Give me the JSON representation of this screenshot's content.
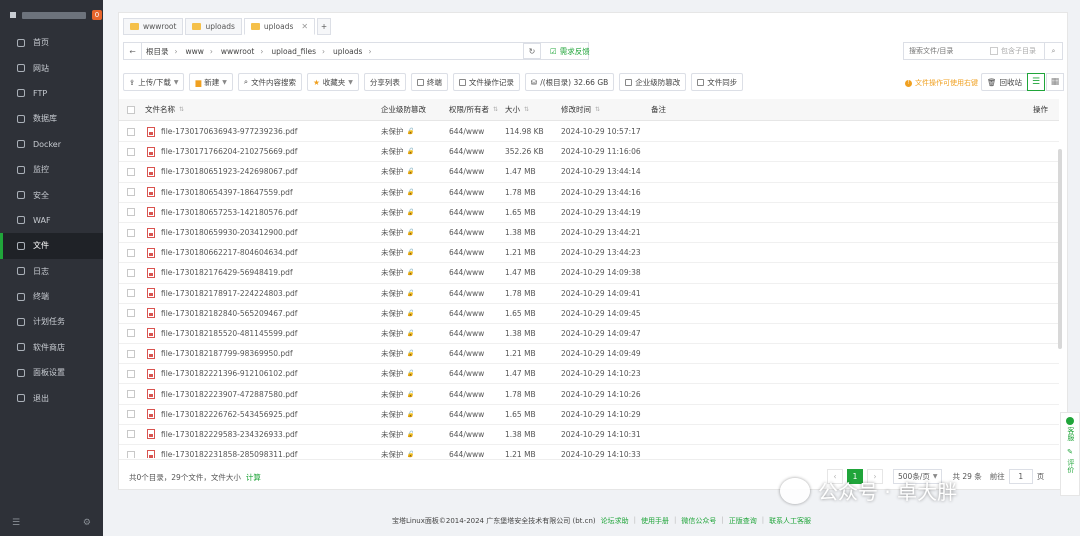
{
  "sidebar": {
    "badge": "0",
    "items": [
      {
        "label": "首页",
        "icon": "home-icon"
      },
      {
        "label": "网站",
        "icon": "globe-icon"
      },
      {
        "label": "FTP",
        "icon": "ftp-icon"
      },
      {
        "label": "数据库",
        "icon": "database-icon"
      },
      {
        "label": "Docker",
        "icon": "docker-icon"
      },
      {
        "label": "监控",
        "icon": "monitor-icon"
      },
      {
        "label": "安全",
        "icon": "shield-icon"
      },
      {
        "label": "WAF",
        "icon": "waf-icon"
      },
      {
        "label": "文件",
        "icon": "folder-icon",
        "active": true
      },
      {
        "label": "日志",
        "icon": "log-icon"
      },
      {
        "label": "终端",
        "icon": "terminal-icon"
      },
      {
        "label": "计划任务",
        "icon": "clock-icon"
      },
      {
        "label": "软件商店",
        "icon": "store-icon"
      },
      {
        "label": "面板设置",
        "icon": "settings-icon"
      },
      {
        "label": "退出",
        "icon": "logout-icon"
      }
    ]
  },
  "tabs": [
    {
      "label": "wwwroot"
    },
    {
      "label": "uploads"
    },
    {
      "label": "uploads",
      "active": true
    }
  ],
  "tab_add": "+",
  "tab_close": "✕",
  "path": {
    "crumbs": [
      "根目录",
      "www",
      "wwwroot",
      "upload_files",
      "uploads"
    ],
    "feedback": "需求反馈"
  },
  "search": {
    "placeholder": "搜索文件/目录",
    "include_sub": "包含子目录"
  },
  "toolbar": {
    "upload": "上传/下载",
    "new": "新建",
    "content_search": "文件内容搜索",
    "favorites": "收藏夹",
    "share_list": "分享列表",
    "terminal": "终端",
    "op_log": "文件操作记录",
    "disk": "/(根目录) 32.66 GB",
    "tamper": "企业级防篡改",
    "sync": "文件同步",
    "warning": "文件操作可使用右键",
    "recycle": "回收站"
  },
  "table": {
    "headers": {
      "name": "文件名称",
      "protect": "企业级防篡改",
      "perm": "权限/所有者",
      "size": "大小",
      "mtime": "修改时间",
      "note": "备注",
      "ops": "操作"
    },
    "rows": [
      {
        "name": "file-1730170636943-977239236.pdf",
        "protect": "未保护",
        "perm": "644/www",
        "size": "114.98 KB",
        "mtime": "2024-10-29 10:57:17"
      },
      {
        "name": "file-1730171766204-210275669.pdf",
        "protect": "未保护",
        "perm": "644/www",
        "size": "352.26 KB",
        "mtime": "2024-10-29 11:16:06"
      },
      {
        "name": "file-1730180651923-242698067.pdf",
        "protect": "未保护",
        "perm": "644/www",
        "size": "1.47 MB",
        "mtime": "2024-10-29 13:44:14"
      },
      {
        "name": "file-1730180654397-18647559.pdf",
        "protect": "未保护",
        "perm": "644/www",
        "size": "1.78 MB",
        "mtime": "2024-10-29 13:44:16"
      },
      {
        "name": "file-1730180657253-142180576.pdf",
        "protect": "未保护",
        "perm": "644/www",
        "size": "1.65 MB",
        "mtime": "2024-10-29 13:44:19"
      },
      {
        "name": "file-1730180659930-203412900.pdf",
        "protect": "未保护",
        "perm": "644/www",
        "size": "1.38 MB",
        "mtime": "2024-10-29 13:44:21"
      },
      {
        "name": "file-1730180662217-804604634.pdf",
        "protect": "未保护",
        "perm": "644/www",
        "size": "1.21 MB",
        "mtime": "2024-10-29 13:44:23"
      },
      {
        "name": "file-1730182176429-56948419.pdf",
        "protect": "未保护",
        "perm": "644/www",
        "size": "1.47 MB",
        "mtime": "2024-10-29 14:09:38"
      },
      {
        "name": "file-1730182178917-224224803.pdf",
        "protect": "未保护",
        "perm": "644/www",
        "size": "1.78 MB",
        "mtime": "2024-10-29 14:09:41"
      },
      {
        "name": "file-1730182182840-565209467.pdf",
        "protect": "未保护",
        "perm": "644/www",
        "size": "1.65 MB",
        "mtime": "2024-10-29 14:09:45"
      },
      {
        "name": "file-1730182185520-481145599.pdf",
        "protect": "未保护",
        "perm": "644/www",
        "size": "1.38 MB",
        "mtime": "2024-10-29 14:09:47"
      },
      {
        "name": "file-1730182187799-98369950.pdf",
        "protect": "未保护",
        "perm": "644/www",
        "size": "1.21 MB",
        "mtime": "2024-10-29 14:09:49"
      },
      {
        "name": "file-1730182221396-912106102.pdf",
        "protect": "未保护",
        "perm": "644/www",
        "size": "1.47 MB",
        "mtime": "2024-10-29 14:10:23"
      },
      {
        "name": "file-1730182223907-472887580.pdf",
        "protect": "未保护",
        "perm": "644/www",
        "size": "1.78 MB",
        "mtime": "2024-10-29 14:10:26"
      },
      {
        "name": "file-1730182226762-543456925.pdf",
        "protect": "未保护",
        "perm": "644/www",
        "size": "1.65 MB",
        "mtime": "2024-10-29 14:10:29"
      },
      {
        "name": "file-1730182229583-234326933.pdf",
        "protect": "未保护",
        "perm": "644/www",
        "size": "1.38 MB",
        "mtime": "2024-10-29 14:10:31"
      },
      {
        "name": "file-1730182231858-285098311.pdf",
        "protect": "未保护",
        "perm": "644/www",
        "size": "1.21 MB",
        "mtime": "2024-10-29 14:10:33"
      }
    ]
  },
  "footer": {
    "summary": "共0个目录，29个文件，文件大小",
    "calc": "计算",
    "current_page": "1",
    "page_size": "500条/页",
    "total": "共 29 条",
    "goto": "前往",
    "goto_value": "1",
    "page_unit": "页"
  },
  "copyright": {
    "text": "宝塔Linux面板©2014-2024 广东堡塔安全技术有限公司 (bt.cn)",
    "links": [
      "论坛求助",
      "使用手册",
      "微信公众号",
      "正版查询",
      "联系人工客服"
    ]
  },
  "side_float": {
    "service": "客服",
    "review": "评价"
  },
  "watermark": "公众号 · 卓大胖",
  "colors": {
    "accent": "#20a53a",
    "sidebar_bg": "#2e3138",
    "warning": "#f0a020",
    "badge": "#e8652b"
  }
}
